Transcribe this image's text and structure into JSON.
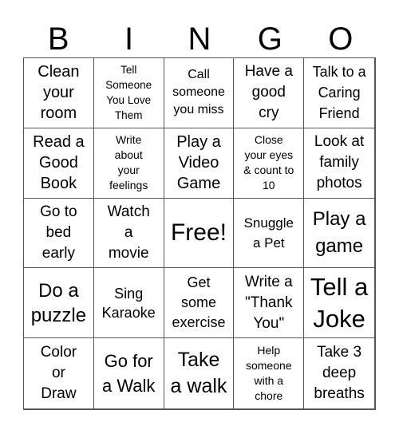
{
  "header": {
    "letters": [
      "B",
      "I",
      "N",
      "G",
      "O"
    ]
  },
  "cells": [
    {
      "text": "Clean your room",
      "lines": [
        "Clean",
        "your",
        "room"
      ]
    },
    {
      "text": "Tell Someone You Love Them",
      "lines": [
        "Tell",
        "Someone",
        "You Love",
        "Them"
      ]
    },
    {
      "text": "Call someone you miss",
      "lines": [
        "Call",
        "someone",
        "you miss"
      ]
    },
    {
      "text": "Have a good cry",
      "lines": [
        "Have a",
        "good",
        "cry"
      ]
    },
    {
      "text": "Talk to a Caring Friend",
      "lines": [
        "Talk to a",
        "Caring",
        "Friend"
      ]
    },
    {
      "text": "Read a Good Book",
      "lines": [
        "Read a",
        "Good",
        "Book"
      ]
    },
    {
      "text": "Write about your feelings",
      "lines": [
        "Write",
        "about",
        "your",
        "feelings"
      ]
    },
    {
      "text": "Play a Video Game",
      "lines": [
        "Play a",
        "Video",
        "Game"
      ]
    },
    {
      "text": "Close your eyes & count to 10",
      "lines": [
        "Close",
        "your eyes",
        "& count to",
        "10"
      ]
    },
    {
      "text": "Look at family photos",
      "lines": [
        "Look at",
        "family",
        "photos"
      ]
    },
    {
      "text": "Go to bed early",
      "lines": [
        "Go to",
        "bed",
        "early"
      ]
    },
    {
      "text": "Watch a movie",
      "lines": [
        "Watch",
        "a",
        "movie"
      ]
    },
    {
      "text": "Free!",
      "lines": [
        "Free!"
      ]
    },
    {
      "text": "Snuggle a Pet",
      "lines": [
        "Snuggle",
        "a Pet"
      ]
    },
    {
      "text": "Play a game",
      "lines": [
        "Play a",
        "game"
      ]
    },
    {
      "text": "Do a puzzle",
      "lines": [
        "Do a",
        "puzzle"
      ]
    },
    {
      "text": "Sing Karaoke",
      "lines": [
        "Sing",
        "Karaoke"
      ]
    },
    {
      "text": "Get some exercise",
      "lines": [
        "Get",
        "some",
        "exercise"
      ]
    },
    {
      "text": "Write a \"Thank You\"",
      "lines": [
        "Write a",
        "\"Thank",
        "You\""
      ]
    },
    {
      "text": "Tell a Joke",
      "lines": [
        "Tell a",
        "Joke"
      ]
    },
    {
      "text": "Color or Draw",
      "lines": [
        "Color",
        "or",
        "Draw"
      ]
    },
    {
      "text": "Go for a Walk",
      "lines": [
        "Go for",
        "a Walk"
      ]
    },
    {
      "text": "Take a walk",
      "lines": [
        "Take",
        "a walk"
      ]
    },
    {
      "text": "Help someone with a chore",
      "lines": [
        "Help",
        "someone",
        "with a",
        "chore"
      ]
    },
    {
      "text": "Take 3 deep breaths",
      "lines": [
        "Take 3",
        "deep",
        "breaths"
      ]
    }
  ]
}
